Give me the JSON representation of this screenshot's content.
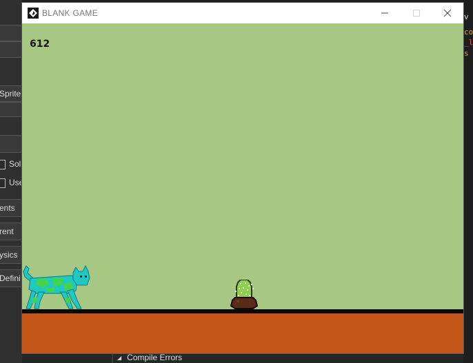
{
  "window": {
    "title": "BLANK GAME",
    "minimize_icon": "minimize-icon",
    "maximize_icon": "maximize-icon",
    "close_icon": "close-icon"
  },
  "game": {
    "score": "612",
    "colors": {
      "sky": "#a6c883",
      "ground": "#c4561a",
      "ground_line": "#080808",
      "cat_body": "#1fc8c0",
      "cat_spots": "#44d34c",
      "cactus": "#8fce52",
      "pot": "#5a2a1a"
    },
    "sprites": [
      "cat-sprite",
      "cactus-sprite"
    ]
  },
  "background_ide": {
    "left_panel": [
      "Sprite",
      "Soli",
      "Use",
      "ents",
      "rent",
      "ysics",
      "Defini"
    ],
    "bottom_tab": "Compile Errors",
    "right_fragments": [
      "v G",
      "cor",
      "_l",
      "s st"
    ]
  }
}
